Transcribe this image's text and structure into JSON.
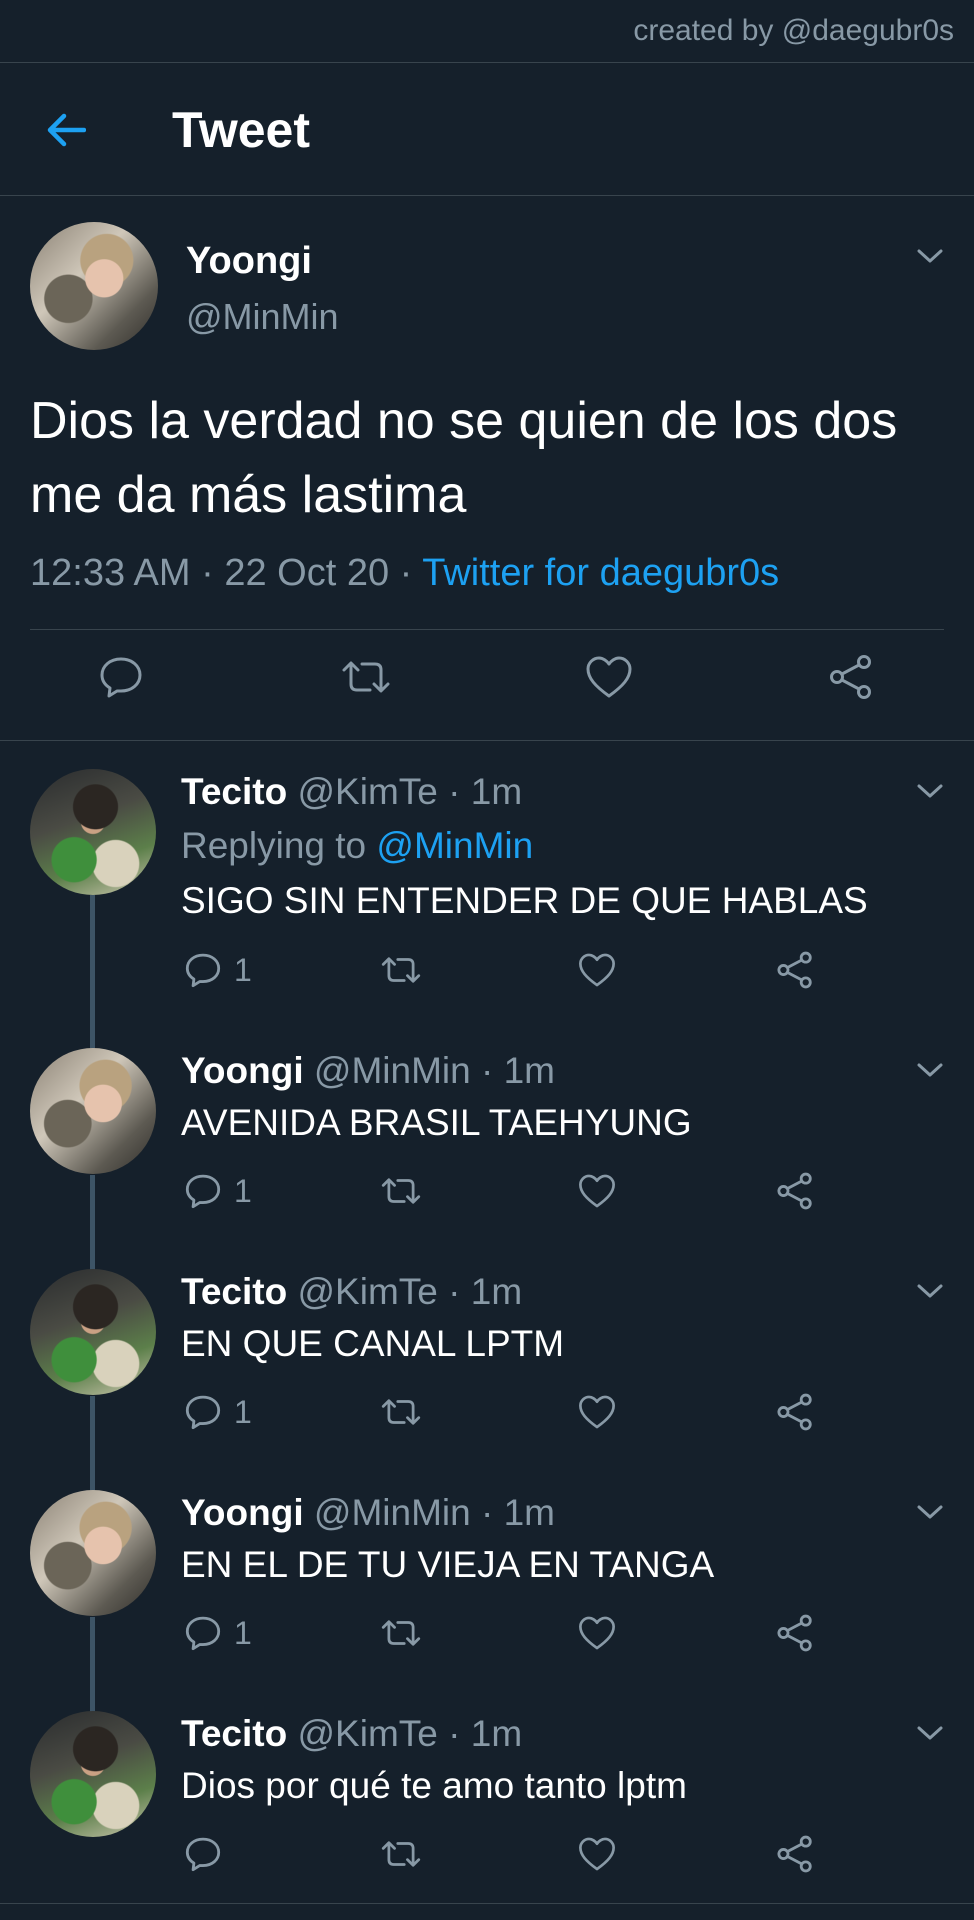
{
  "watermark": "created by @daegubr0s",
  "header": {
    "title": "Tweet",
    "back_icon": "arrow-left-icon"
  },
  "colors": {
    "background": "#15202b",
    "accent": "#1da1f2",
    "secondary_text": "#8899a6",
    "divider": "#38444d"
  },
  "main_tweet": {
    "name": "Yoongi",
    "handle": "@MinMin",
    "text": "Dios la verdad no se quien de los dos me da más lastima",
    "time": "12:33 AM",
    "date": "22 Oct 20",
    "separator": "·",
    "source": "Twitter for daegubr0s"
  },
  "replies": [
    {
      "name": "Tecito",
      "handle": "@KimTe",
      "dot": "·",
      "time": "1m",
      "replying_label": "Replying to",
      "replying_to": "@MinMin",
      "text": "SIGO SIN ENTENDER DE QUE HABLAS",
      "reply_count": "1"
    },
    {
      "name": "Yoongi",
      "handle": "@MinMin",
      "dot": "·",
      "time": "1m",
      "text": "AVENIDA BRASIL TAEHYUNG",
      "reply_count": "1"
    },
    {
      "name": "Tecito",
      "handle": "@KimTe",
      "dot": "·",
      "time": "1m",
      "text": "EN QUE CANAL LPTM",
      "reply_count": "1"
    },
    {
      "name": "Yoongi",
      "handle": "@MinMin",
      "dot": "·",
      "time": "1m",
      "text": "EN EL DE TU VIEJA EN TANGA",
      "reply_count": "1"
    },
    {
      "name": "Tecito",
      "handle": "@KimTe",
      "dot": "·",
      "time": "1m",
      "text": "Dios por qué te amo tanto lptm",
      "reply_count": ""
    }
  ]
}
